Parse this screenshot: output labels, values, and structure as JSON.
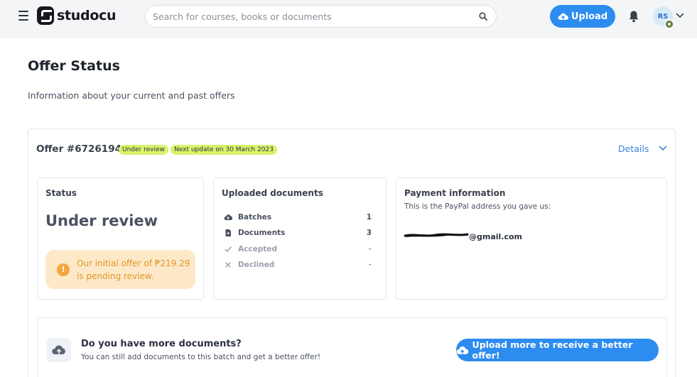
{
  "header": {
    "logo_text": "studocu",
    "search_placeholder": "Search for courses, books or documents",
    "upload_label": "Upload",
    "avatar_initials": "RS"
  },
  "page": {
    "title": "Offer Status",
    "subtitle": "Information about your current and past offers"
  },
  "offer": {
    "title": "Offer #6726194",
    "status_tag": "Under review",
    "update_tag": "Next update on 30 March 2023",
    "details_label": "Details",
    "status_panel": {
      "heading": "Status",
      "status_value": "Under review",
      "pending_text": "Our initial offer of ₱219.29 is pending review."
    },
    "documents_panel": {
      "heading": "Uploaded documents",
      "rows": [
        {
          "label": "Batches",
          "value": "1",
          "icon": "cloud-upload-icon"
        },
        {
          "label": "Documents",
          "value": "3",
          "icon": "document-icon"
        },
        {
          "label": "Accepted",
          "value": "-",
          "icon": "check-icon"
        },
        {
          "label": "Declined",
          "value": "-",
          "icon": "x-icon"
        }
      ]
    },
    "payment_panel": {
      "heading": "Payment information",
      "subtext": "This is the PayPal address you gave us:",
      "email_visible": "@gmail.com"
    },
    "more_panel": {
      "title": "Do you have more documents?",
      "subtitle": "You can still add documents to this batch and get a better offer!",
      "button_label": "Upload more to receive a better offer!"
    }
  },
  "colors": {
    "accent": "#2d8cf0",
    "tag_bg": "#d9f26a",
    "pending_bg": "#fde9c8",
    "pending_text": "#e29428"
  }
}
